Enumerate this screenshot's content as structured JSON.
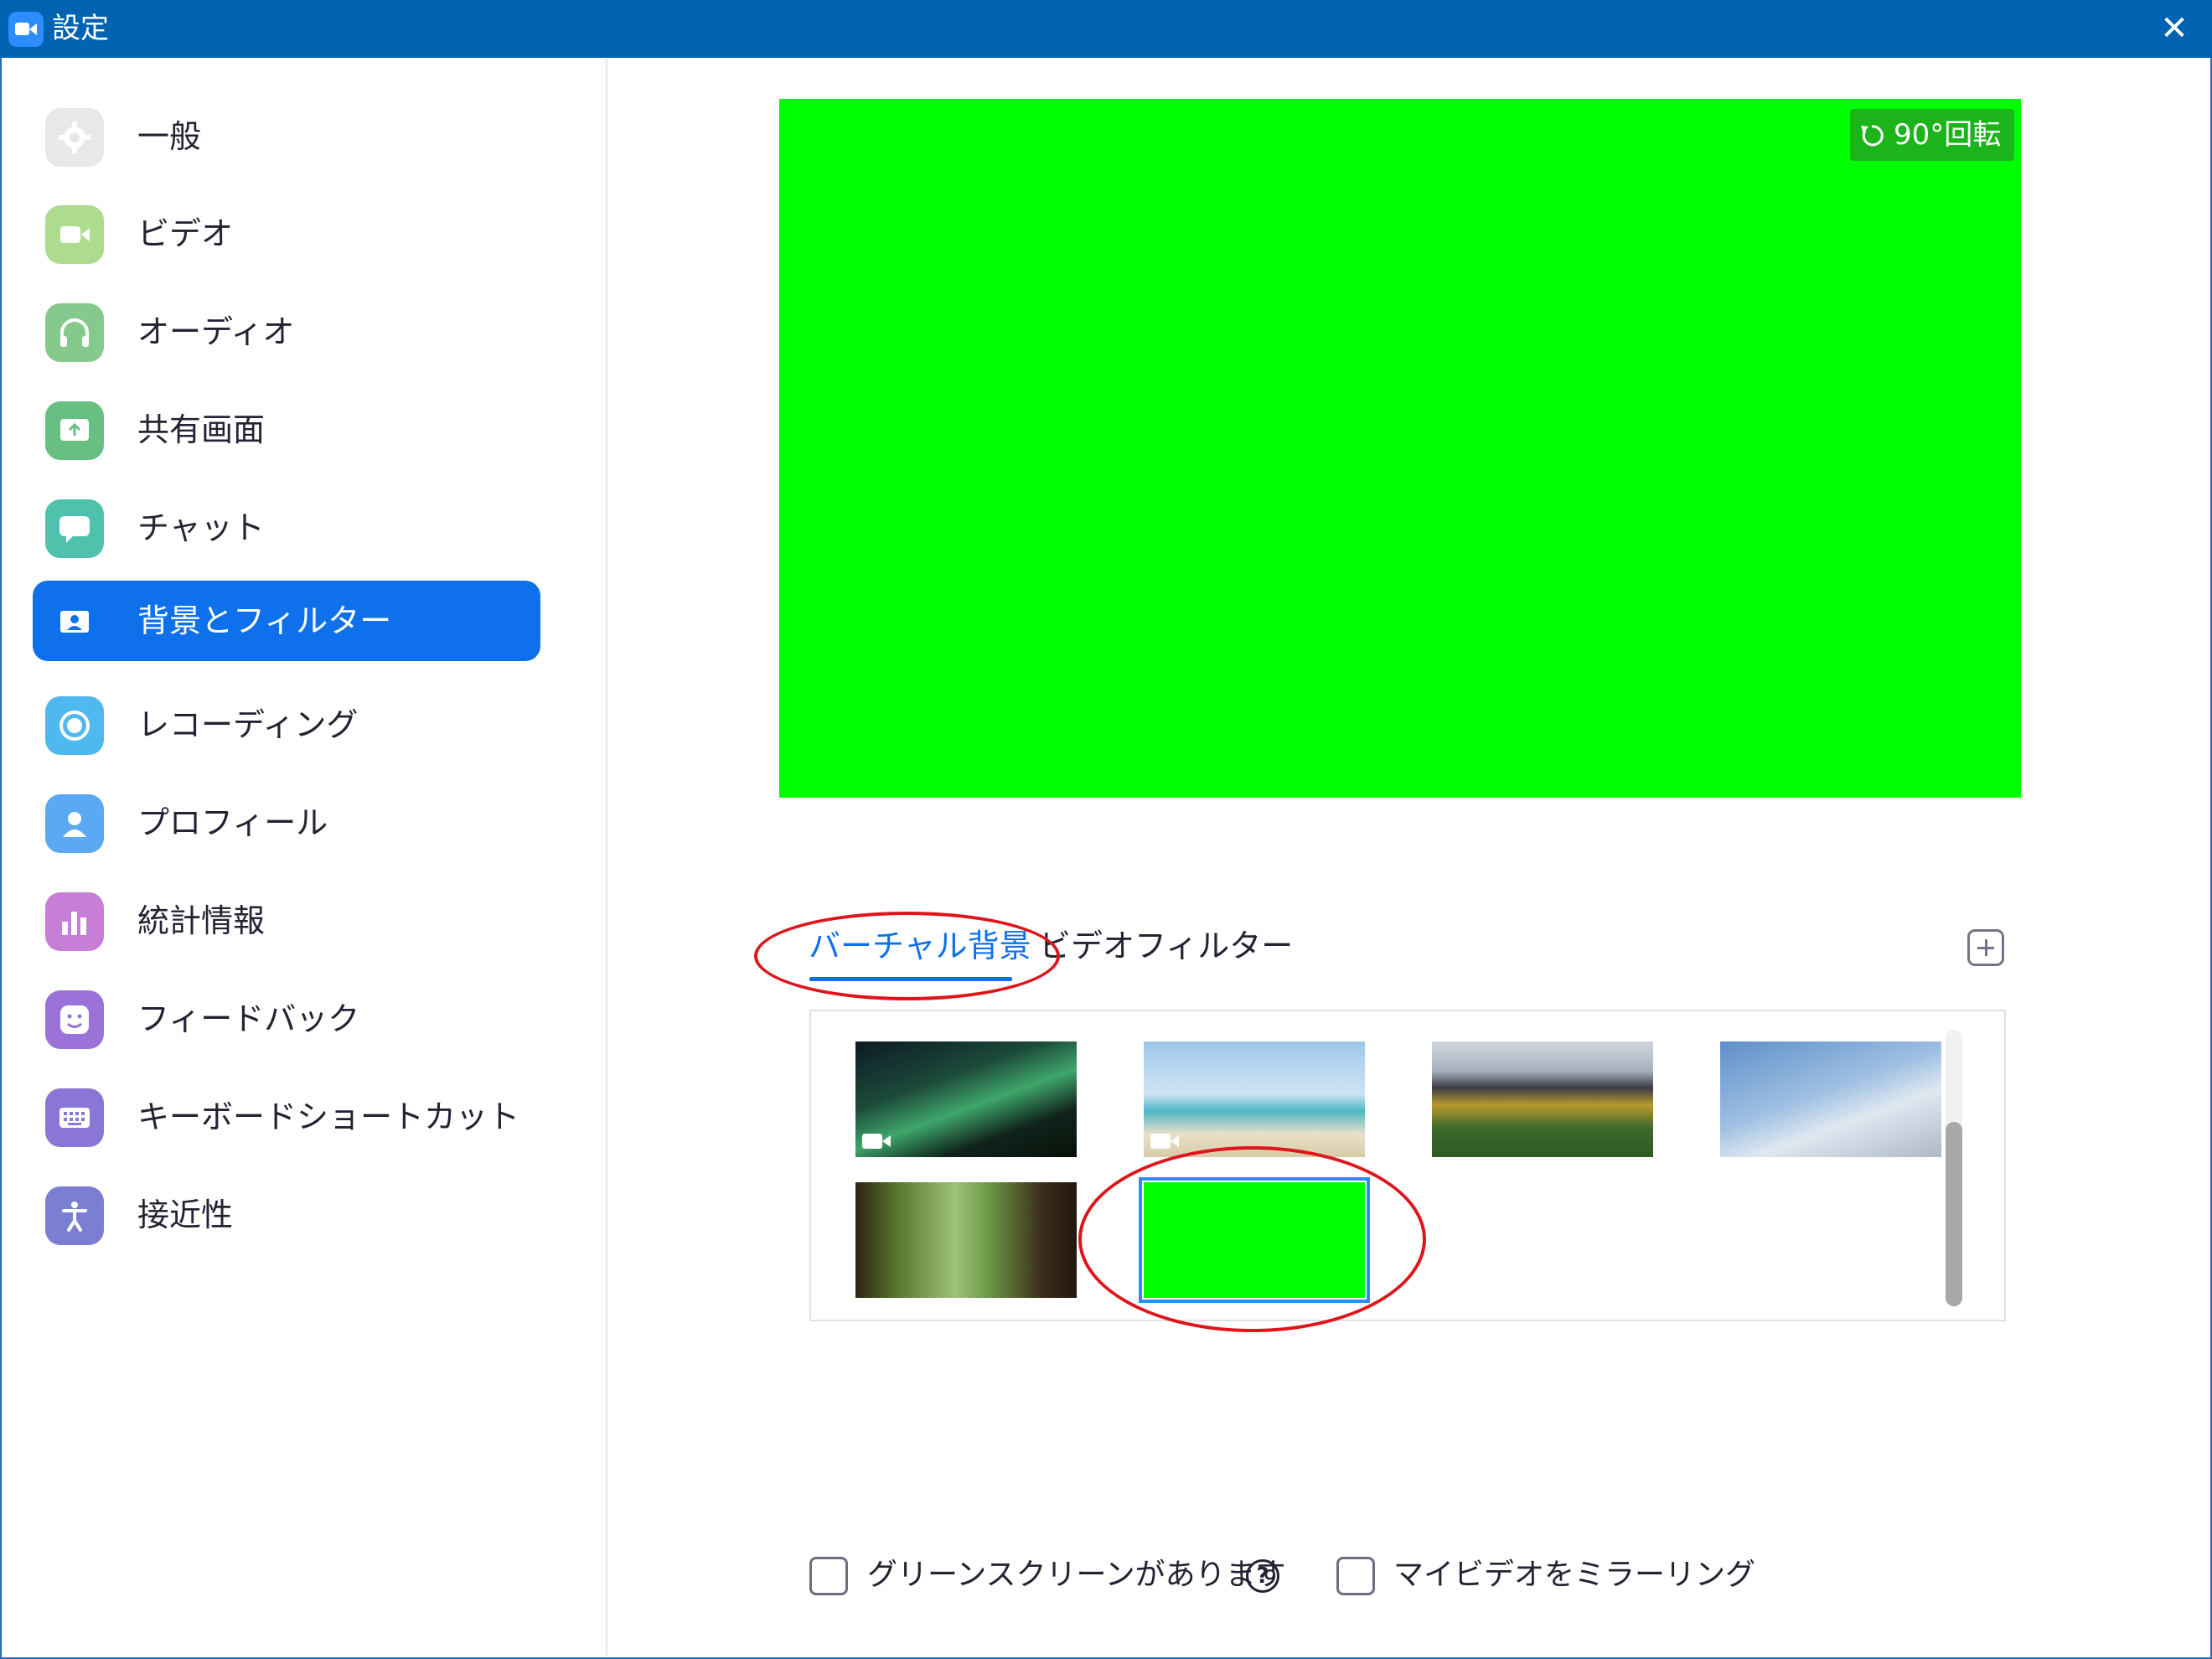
{
  "window": {
    "title": "設定",
    "close_glyph": "✕"
  },
  "sidebar": {
    "items": [
      {
        "label": "一般",
        "icon": "gear-icon",
        "color": "#e8e8e8"
      },
      {
        "label": "ビデオ",
        "icon": "video-camera-icon",
        "color": "#aedc8e"
      },
      {
        "label": "オーディオ",
        "icon": "headphones-icon",
        "color": "#86c98c"
      },
      {
        "label": "共有画面",
        "icon": "share-screen-icon",
        "color": "#67c082"
      },
      {
        "label": "チャット",
        "icon": "chat-bubble-icon",
        "color": "#4fc2ad"
      },
      {
        "label": "背景とフィルター",
        "icon": "background-person-icon",
        "color": "#0e71eb",
        "active": true
      },
      {
        "label": "レコーディング",
        "icon": "record-icon",
        "color": "#4fb8ef"
      },
      {
        "label": "プロフィール",
        "icon": "profile-icon",
        "color": "#5aa9f2"
      },
      {
        "label": "統計情報",
        "icon": "bar-chart-icon",
        "color": "#c77ed6"
      },
      {
        "label": "フィードバック",
        "icon": "smiley-icon",
        "color": "#9a72d8"
      },
      {
        "label": "キーボードショートカット",
        "icon": "keyboard-icon",
        "color": "#8a76d6"
      },
      {
        "label": "接近性",
        "icon": "accessibility-icon",
        "color": "#7a7fd4"
      }
    ]
  },
  "preview": {
    "background_color": "#00ff00",
    "rotate_label": "90°回転"
  },
  "tabs": {
    "virtual_background": "バーチャル背景",
    "video_filter": "ビデオフィルター"
  },
  "gallery": {
    "thumbnails": [
      {
        "name": "aurora",
        "type": "video"
      },
      {
        "name": "beach",
        "type": "video"
      },
      {
        "name": "stadium",
        "type": "image"
      },
      {
        "name": "airplane-wing",
        "type": "image"
      },
      {
        "name": "forest",
        "type": "image"
      },
      {
        "name": "green-screen",
        "type": "image",
        "selected": true
      }
    ]
  },
  "options": {
    "green_screen_label": "グリーンスクリーンがあります",
    "green_screen_checked": false,
    "help_glyph": "?",
    "mirror_label": "マイビデオをミラーリング",
    "mirror_checked": false
  },
  "colors": {
    "accent": "#0e71eb",
    "annotation": "#e0151b",
    "titlebar": "#0063b1"
  }
}
